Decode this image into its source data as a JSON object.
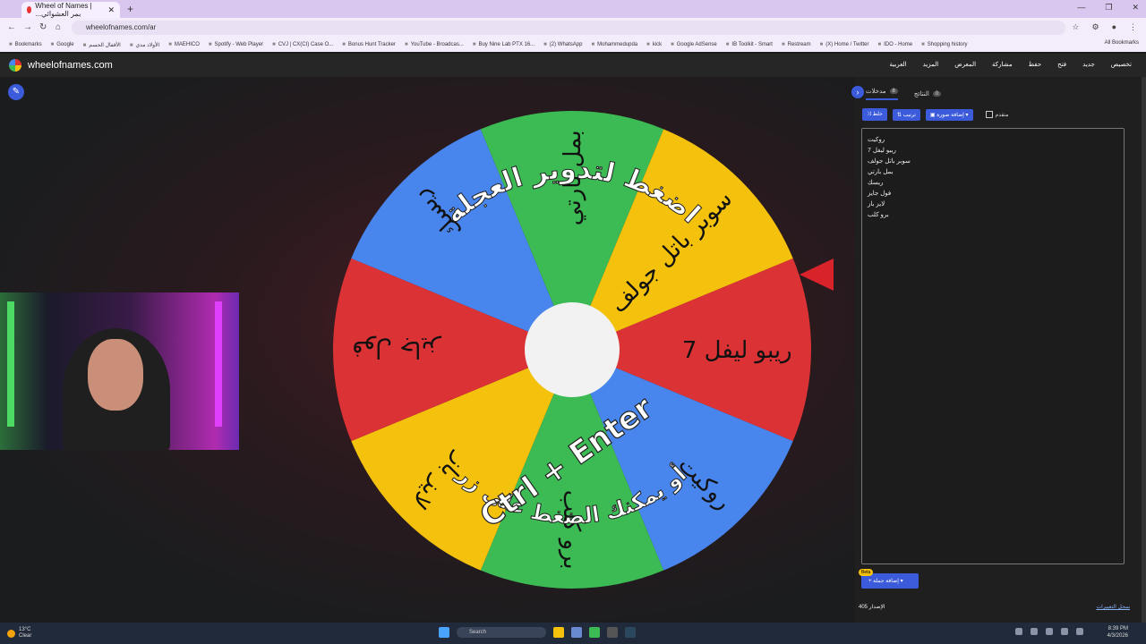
{
  "browser": {
    "tab_title": "Wheel of Names | ...بمر العشوائي",
    "url": "wheelofnames.com/ar",
    "bookmarks": [
      "Bookmarks",
      "Google",
      "الأقفال الحسم",
      "الأولاد مدي",
      "MAEHICO",
      "Spotify - Web Player",
      "CVJ | CX(CI) Case O...",
      "Bonus Hunt Tracker",
      "YouTube - Broadcas...",
      "Buy Nine Lab PTX 16...",
      "(2) WhatsApp",
      "Mohammedupda",
      "kick",
      "Google AdSense",
      "IB Toolkit - Smart",
      "Restream",
      "(X) Home / Twitter",
      "IDO - Home",
      "Shopping history"
    ],
    "all_bookmarks": "All Bookmarks"
  },
  "app": {
    "brand": "wheelofnames.com",
    "menu": [
      "تخصيص",
      "جديد",
      "فتح",
      "حفظ",
      "مشاركة",
      "المعرض",
      "",
      "المزيد",
      "العربية"
    ]
  },
  "wheel": {
    "center_text_line1": "اضغط لتدوير العجلة",
    "center_text_line2": "أو يمكنك الضغط على زر",
    "shortcut": "Ctrl + Enter",
    "segments": [
      {
        "label": "ريبو ليفل 7",
        "color": "#db3236"
      },
      {
        "label": "روكيت",
        "color": "#4885ed"
      },
      {
        "label": "برو كلب",
        "color": "#3cba54"
      },
      {
        "label": "لايز باز",
        "color": "#f4c20d"
      },
      {
        "label": "فول جايز",
        "color": "#db3236"
      },
      {
        "label": "ريسك",
        "color": "#4885ed"
      },
      {
        "label": "بمل بارتي",
        "color": "#3cba54"
      },
      {
        "label": "سوبر باتل جولف",
        "color": "#f4c20d"
      }
    ]
  },
  "panel": {
    "tabs": [
      {
        "label": "مدخلات",
        "count": "8"
      },
      {
        "label": "النتائج",
        "count": "0"
      }
    ],
    "shuffle": "خلط",
    "sort": "ترتيب",
    "add_image": "إضافة صورة",
    "advanced": "متقدم",
    "entries": [
      "روكيت",
      "ريبو ليفل 7",
      "سوبر باتل جولف",
      "بمل بارتي",
      "ريسك",
      "فول جايز",
      "لايز باز",
      "برو كلب"
    ],
    "beta": "Beta",
    "add_sheet": "إضافة جملة",
    "version": "الإصدار 405",
    "changelog": "سجل التغييرات"
  },
  "taskbar": {
    "temp": "13°C",
    "weather": "Clear",
    "search": "Search",
    "time": "8:39 PM",
    "date": "4/3/2026"
  }
}
